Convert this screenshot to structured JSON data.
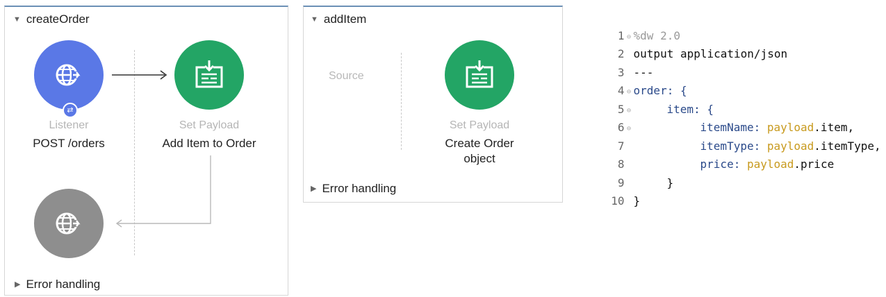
{
  "flow1": {
    "title": "createOrder",
    "listener": {
      "type": "Listener",
      "name": "POST /orders"
    },
    "set_payload": {
      "type": "Set Payload",
      "name": "Add Item to Order"
    },
    "error_handling": "Error handling"
  },
  "flow2": {
    "title": "addItem",
    "source_placeholder": "Source",
    "set_payload": {
      "type": "Set Payload",
      "name_line1": "Create Order",
      "name_line2": "object"
    },
    "error_handling": "Error handling"
  },
  "code": {
    "lines": [
      {
        "n": "1",
        "text": "%dw 2.0"
      },
      {
        "n": "2",
        "text": "output application/json"
      },
      {
        "n": "3",
        "text": "---"
      },
      {
        "n": "4",
        "text": "order: {"
      },
      {
        "n": "5",
        "text": "item: {"
      },
      {
        "n": "6",
        "key": "itemName: ",
        "obj": "payload",
        "rest": ".item,"
      },
      {
        "n": "7",
        "key": "itemType: ",
        "obj": "payload",
        "rest": ".itemType,"
      },
      {
        "n": "8",
        "key": "price: ",
        "obj": "payload",
        "rest": ".price"
      },
      {
        "n": "9",
        "text": "}"
      },
      {
        "n": "10",
        "text": "}"
      }
    ]
  },
  "colors": {
    "listener": "#5a78e6",
    "set_payload": "#23a565",
    "response": "#8e8e8e",
    "payload_keyword": "#c89a1e"
  }
}
